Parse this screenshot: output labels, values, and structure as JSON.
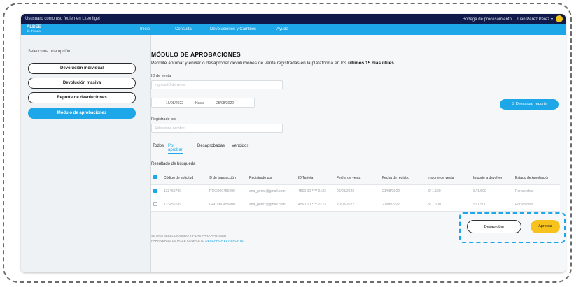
{
  "topbar": {
    "welcome_text": "Ususuaro como usd feulen en Litee ligel",
    "right_text": "Bodega de procesamiento",
    "user_name": "Juan Pérez Pérez"
  },
  "navbar": {
    "logo_line1": "ALBEE",
    "logo_line2": "de Tienda",
    "items": [
      "Inicio",
      "Consulta",
      "Devoluciones y Cambios",
      "Ayuda"
    ]
  },
  "sidebar": {
    "title": "Selecciona una opción",
    "items": [
      {
        "label": "Devolución individual",
        "active": false
      },
      {
        "label": "Devolución masiva",
        "active": false
      },
      {
        "label": "Reporte de devoluciones",
        "active": false
      },
      {
        "label": "Módulo de aprobaciones",
        "active": true
      }
    ]
  },
  "main": {
    "title": "MÓDULO DE APROBACIONES",
    "subtitle_prefix": "Permite aprobar y enviar o desaprobar devoluciones de venta registradas en la plataforma en los ",
    "subtitle_bold": "últimos 15 días útiles.",
    "sale_id_label": "ID de venta",
    "sale_id_placeholder": "Ingresa ID de venta",
    "date_from": "16/08/2022",
    "date_separator": "Hasta",
    "date_to": "25/08/2022",
    "registered_by_label": "Registrado por",
    "registered_by_placeholder": "Selecciona nombre",
    "download_button": "Descargar reporte",
    "tabs": [
      {
        "label": "Todos",
        "active": false
      },
      {
        "label": "Por aprobar",
        "active": true
      },
      {
        "label": "Desaprobadas",
        "active": false
      },
      {
        "label": "Vencidos",
        "active": false
      }
    ],
    "results_title": "Resultado de búsqueda",
    "table": {
      "headers": [
        "Código de solicitud",
        "ID de transacción",
        "Registrado por",
        "ID Tarjeta",
        "Fecha de venta",
        "Fecha de registro",
        "Importe de venta",
        "Importe a devolver",
        "Estado de Aprobación"
      ],
      "rows": [
        {
          "checked": true,
          "cells": [
            "123456789",
            "TRX0000456000",
            "ana_perez@gmail.com",
            "4560 00 **** 0123",
            "20/08/2022",
            "21/08/2022",
            "S/ 1.500",
            "S/ 1.500",
            "Por aprobar"
          ]
        },
        {
          "checked": false,
          "cells": [
            "123456789",
            "TRX0000456000",
            "ana_perez@gmail.com",
            "4560 00 **** 0123",
            "20/08/2022",
            "21/08/2022",
            "S/ 1.500",
            "S/ 1.500",
            "Por aprobar"
          ]
        }
      ]
    },
    "footer_line1": "SE HAN SELECCIONADO 2 FILAS PARA APROBAR",
    "footer_line2_prefix": "PARA VER EL DETALLE COMPLETO ",
    "footer_link": "DESCARGA EL REPORTE",
    "reject_button": "Desaprobar",
    "approve_button": "Aprobar"
  },
  "colors": {
    "accent": "#1ea7e8",
    "topbar": "#101a4a",
    "approve": "#f7c21c"
  }
}
